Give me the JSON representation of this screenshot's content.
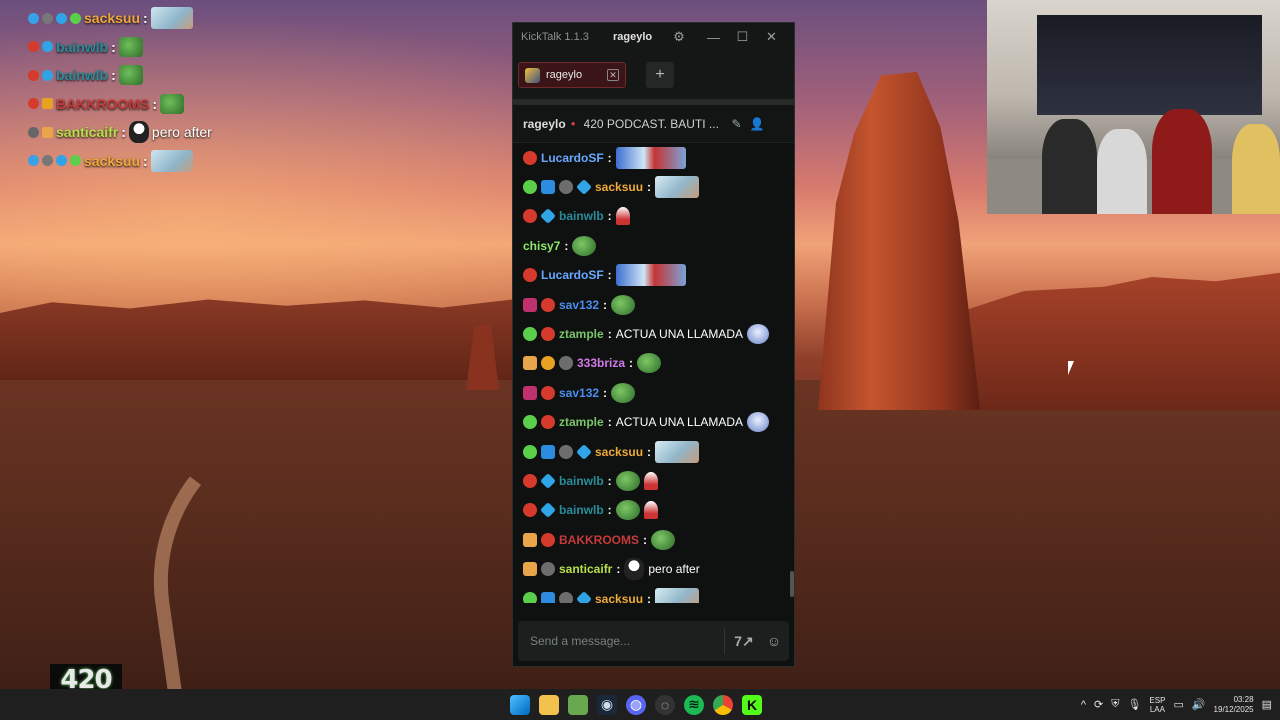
{
  "overlay_chat": [
    {
      "user": "sacksuu",
      "color": "#f0a93b",
      "msg": "",
      "emote": "face"
    },
    {
      "user": "bainwlb",
      "color": "#2a8c9a",
      "msg": "",
      "emote": "frog"
    },
    {
      "user": "bainwlb",
      "color": "#2a8c9a",
      "msg": "",
      "emote": "frog"
    },
    {
      "user": "BAKKROOMS",
      "color": "#c63a3a",
      "msg": "",
      "emote": "frog"
    },
    {
      "user": "santicaifr",
      "color": "#b6e04a",
      "msg": "pero after",
      "emote": "ghost"
    },
    {
      "user": "sacksuu",
      "color": "#f0a93b",
      "msg": "",
      "emote": "face"
    }
  ],
  "kicktalk": {
    "app_title": "KickTalk 1.1.3",
    "username": "rageylo",
    "gear_icon": "gear-icon",
    "minimize": "—",
    "maximize": "☐",
    "close": "✕",
    "tab_label": "rageylo",
    "add_tab": "+",
    "channel_name": "rageylo",
    "stream_title": "420 PODCAST. BAUTI ...",
    "input_placeholder": "Send a message...",
    "messages": [
      {
        "user": "LucardoSF",
        "color": "#6aa8ff",
        "text": ""
      },
      {
        "user": "sacksuu",
        "color": "#f0a93b",
        "text": ""
      },
      {
        "user": "bainwlb",
        "color": "#2a8c9a",
        "text": ""
      },
      {
        "user": "chisy7",
        "color": "#8ce86a",
        "text": ""
      },
      {
        "user": "LucardoSF",
        "color": "#6aa8ff",
        "text": ""
      },
      {
        "user": "sav132",
        "color": "#4a8ef0",
        "text": ""
      },
      {
        "user": "ztample",
        "color": "#7ac46a",
        "text": "ACTUA UNA LLAMADA"
      },
      {
        "user": "333briza",
        "color": "#d27ae8",
        "text": ""
      },
      {
        "user": "sav132",
        "color": "#4a8ef0",
        "text": ""
      },
      {
        "user": "ztample",
        "color": "#7ac46a",
        "text": "ACTUA UNA LLAMADA"
      },
      {
        "user": "sacksuu",
        "color": "#f0a93b",
        "text": ""
      },
      {
        "user": "bainwlb",
        "color": "#2a8c9a",
        "text": ""
      },
      {
        "user": "bainwlb",
        "color": "#2a8c9a",
        "text": ""
      },
      {
        "user": "BAKKROOMS",
        "color": "#c63a3a",
        "text": ""
      },
      {
        "user": "santicaifr",
        "color": "#b6e04a",
        "text": "pero after"
      },
      {
        "user": "sacksuu",
        "color": "#f0a93b",
        "text": ""
      }
    ]
  },
  "logo_text": "420",
  "taskbar": {
    "language": "ESP",
    "language_sub": "LAA",
    "time": "03:28",
    "date": "19/12/2025"
  }
}
